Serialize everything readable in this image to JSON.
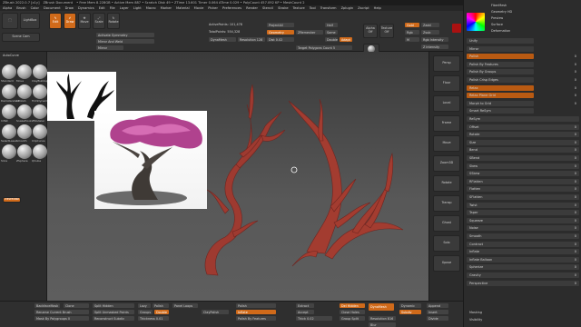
{
  "titlebar": {
    "app": "ZBrush 2022.0.7 [x1y]",
    "doc": "ZBrush Document",
    "stats": "• Free Mem 8.228GB • Active Mem 887 • Scratch Disk 49 • ZTime 13.601 Timer 0.064 ATime 0.029 • PolyCount 457.092 KP • MeshCount 2",
    "quicksave": "QuickSave",
    "seethrough": "See-through 0",
    "menus": "Menus",
    "script": "DefaultZScript"
  },
  "menubar": [
    "Alpha",
    "Brush",
    "Color",
    "Document",
    "Draw",
    "Dynamics",
    "Edit",
    "File",
    "Layer",
    "Light",
    "Macro",
    "Marker",
    "Material",
    "Movie",
    "Picker",
    "Preferences",
    "Render",
    "Stencil",
    "Stroke",
    "Texture",
    "Tool",
    "Transform",
    "Zplugin",
    "Zscript",
    "Help"
  ],
  "toolbar": {
    "lightbox": "LightBox",
    "scenecam": "Scene Cam",
    "edit": "Edit",
    "draw": "Draw",
    "move": "Move",
    "scale": "Scale",
    "rotate": "Rotate",
    "activate_symmetry": "Activate Symmetry",
    "mirror_weld": "Mirror And Weld",
    "mirror": "Mirror",
    "auto_groups": "Auto Groups",
    "group_visible": "GroupVisible",
    "active_points": "ActivePoints: 101,478",
    "total_points": "TotalPoints: 554,328",
    "dynamesh": "DynaMesh",
    "resolution": "Resolution 128",
    "projectall": "ProjectAll",
    "geometry": "Geometry",
    "zremesher": "ZRemesher",
    "half": "Half",
    "same": "Same",
    "double": "Double",
    "adapt": "Adapt",
    "keep_groups": "KeepGroups",
    "target_polygons": "Target Polygons Count 5",
    "dist": "Dist 0.02",
    "alpha_off": "Alpha Off",
    "texture_off": "Texture Off",
    "matcap": "MatCap",
    "gold": "Gold",
    "rgb": "Rgb",
    "rgb_intensity": "Rgb Intensity",
    "z_intensity": "Z Intensity",
    "draw_size": "Draw Size",
    "focal_shift": "Focal Shift",
    "m": "M",
    "zadd": "Zadd",
    "zsub": "Zsub"
  },
  "leftpal": {
    "labels": [
      "Standard",
      "Move",
      "ClayBuildup",
      "Damstandard",
      "hPolish",
      "TrimDynamic",
      "Inflat",
      "SnakeHook",
      "ZModeler",
      "SelectLasso",
      "Smooth",
      "ClipCurve",
      "Slice",
      "ZSphere",
      "QCube"
    ],
    "viewmask": "ViewMask",
    "autocurve": "AutoCurve"
  },
  "rightpal": [
    "Persp",
    "Floor",
    "Local",
    "Frame",
    "Move",
    "Zoom3D",
    "Rotate",
    "Transp",
    "Ghost",
    "Solo",
    "Xpose"
  ],
  "panel": {
    "top": [
      "FiberMesh",
      "Geometry HD",
      "Preview",
      "Surface",
      "Deformation"
    ],
    "rows": [
      {
        "label": "Unify",
        "val": ""
      },
      {
        "label": "Mirror",
        "val": ""
      },
      {
        "label": "Polish",
        "val": "0"
      },
      {
        "label": "Polish By Features",
        "val": "0"
      },
      {
        "label": "Polish By Groups",
        "val": "0"
      },
      {
        "label": "Polish Crisp Edges",
        "val": "0"
      },
      {
        "label": "Relax",
        "val": "0"
      },
      {
        "label": "Relax Plane Grid",
        "val": "0"
      },
      {
        "label": "Morph to Grid",
        "val": "0"
      },
      {
        "label": "Smart ReSym",
        "val": ""
      },
      {
        "label": "ReSym",
        "val": ""
      },
      {
        "label": "Offset",
        "val": "0"
      },
      {
        "label": "Rotate",
        "val": "0"
      },
      {
        "label": "Size",
        "val": "0"
      },
      {
        "label": "Bend",
        "val": "0"
      },
      {
        "label": "SBend",
        "val": "0"
      },
      {
        "label": "Skew",
        "val": "0"
      },
      {
        "label": "SSkew",
        "val": "0"
      },
      {
        "label": "RFlatten",
        "val": "0"
      },
      {
        "label": "Flatten",
        "val": "0"
      },
      {
        "label": "SFlatten",
        "val": "0"
      },
      {
        "label": "Twist",
        "val": "0"
      },
      {
        "label": "Taper",
        "val": "0"
      },
      {
        "label": "Squeeze",
        "val": "0"
      },
      {
        "label": "Noise",
        "val": "0"
      },
      {
        "label": "Smooth",
        "val": "0"
      },
      {
        "label": "Contract",
        "val": "0"
      },
      {
        "label": "Inflate",
        "val": "0"
      },
      {
        "label": "Inflate Balloon",
        "val": "0"
      },
      {
        "label": "Spherize",
        "val": "0"
      },
      {
        "label": "Gravity",
        "val": "0"
      },
      {
        "label": "Perspective",
        "val": "0"
      }
    ],
    "bottom": [
      "Masking",
      "Visibility"
    ]
  },
  "bottom": {
    "backfacemask": "BackfaceMask",
    "clone": "Clone",
    "rename_brush": "Rename Current Brush",
    "mask_by_polygroups": "Mask By Polygroups 0",
    "split_hidden": "Split Hidden",
    "split_unmasked": "Split Unmasked Points",
    "reconstruct_subdiv": "Reconstruct Subdiv",
    "lazy": "Lazy",
    "polish": "Polish",
    "groups": "Groups",
    "double": "Double",
    "thickness": "Thickness 0.01",
    "panel_loops": "Panel Loops",
    "clay_polish": "ClayPolish",
    "polish_by_features": "Polish By Features",
    "inflate": "Inflate",
    "polish2": "Polish",
    "thick": "Thick 0.02",
    "extract": "Extract",
    "accept": "Accept",
    "del_hidden": "Del Hidden",
    "close_holes": "Close Holes",
    "group_split": "Group Split",
    "dynamesh": "DynaMesh",
    "resolution": "Resolution 816",
    "blur": "Blur",
    "dynamic": "Dynamic",
    "subdiv": "Subdiv",
    "append": "Append",
    "insert": "Insert",
    "divide": "Divide"
  }
}
